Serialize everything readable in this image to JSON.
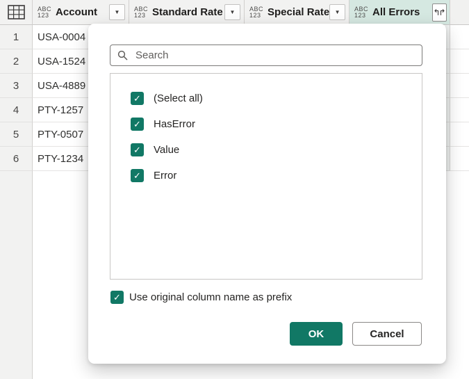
{
  "table": {
    "type_icon": {
      "top": "ABC",
      "bottom": "123"
    },
    "columns": [
      {
        "label": "Account",
        "selected": false
      },
      {
        "label": "Standard Rate",
        "selected": false
      },
      {
        "label": "Special Rate",
        "selected": false
      },
      {
        "label": "All Errors",
        "selected": true
      }
    ],
    "rows": [
      {
        "num": "1",
        "account": "USA-0004"
      },
      {
        "num": "2",
        "account": "USA-1524"
      },
      {
        "num": "3",
        "account": "USA-4889"
      },
      {
        "num": "4",
        "account": "PTY-1257"
      },
      {
        "num": "5",
        "account": "PTY-0507"
      },
      {
        "num": "6",
        "account": "PTY-1234"
      }
    ]
  },
  "dialog": {
    "search": {
      "placeholder": "Search",
      "value": ""
    },
    "options": [
      {
        "label": "(Select all)",
        "checked": true
      },
      {
        "label": "HasError",
        "checked": true
      },
      {
        "label": "Value",
        "checked": true
      },
      {
        "label": "Error",
        "checked": true
      }
    ],
    "prefix_checkbox": {
      "label": "Use original column name as prefix",
      "checked": true
    },
    "buttons": {
      "ok": "OK",
      "cancel": "Cancel"
    }
  },
  "icons": {
    "dropdown": "▼",
    "expand": "↰↱",
    "check": "✓"
  },
  "colors": {
    "accent_teal": "#117865",
    "selected_header_bg": "#d5e8e1",
    "header_bg": "#f2f2f1",
    "grid_border": "#d2d0ce"
  }
}
